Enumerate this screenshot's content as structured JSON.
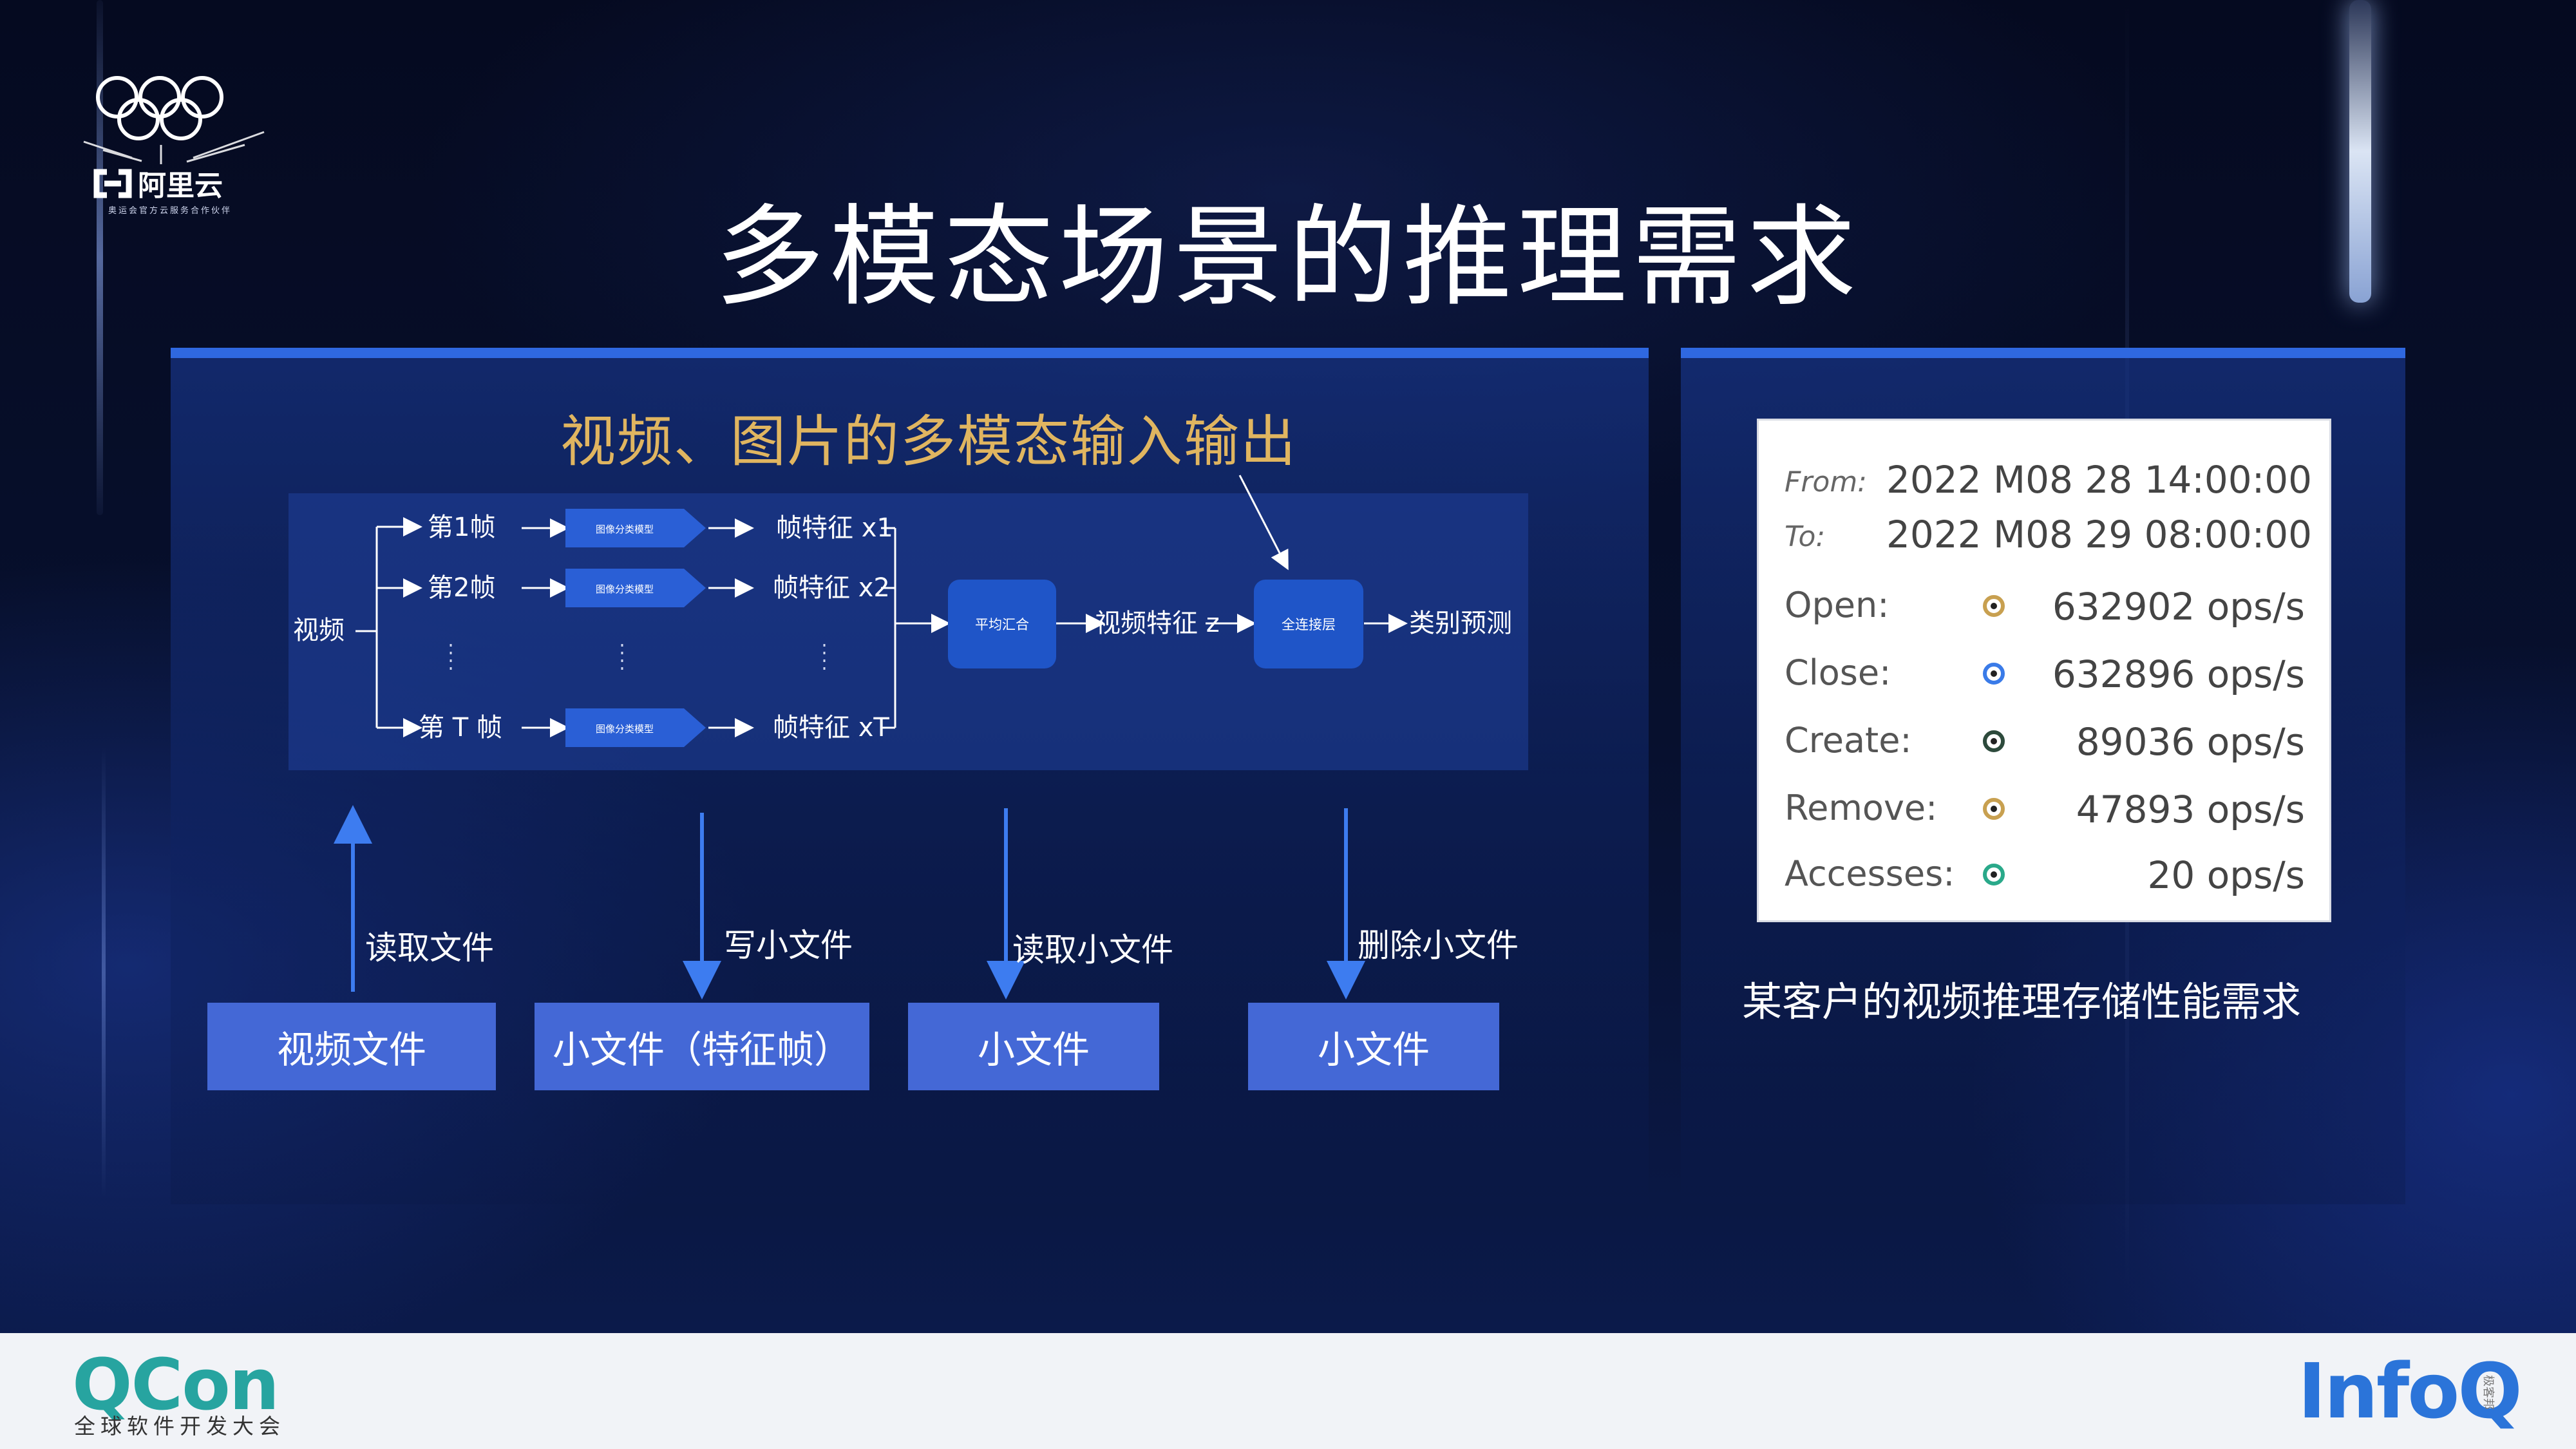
{
  "slide": {
    "title": "多模态场景的推理需求",
    "logo_brand": "阿里云",
    "logo_tagline": "奥运会官方云服务合作伙伴"
  },
  "left_panel": {
    "subtitle": "视频、图片的多模态输入输出",
    "diagram": {
      "source": "视频",
      "frames": [
        "第1帧",
        "第2帧",
        "第 T 帧"
      ],
      "classifier": "图像分类模型",
      "features": [
        "帧特征 x1",
        "帧特征 x2",
        "帧特征 xT"
      ],
      "pool_node": "平均汇合",
      "video_feature": "视频特征 z",
      "fc_node": "全连接层",
      "output": "类别预测"
    },
    "operations": [
      "读取文件",
      "写小文件",
      "读取小文件",
      "删除小文件"
    ],
    "files": [
      "视频文件",
      "小文件（特征帧）",
      "小文件",
      "小文件"
    ]
  },
  "right_panel": {
    "stats": {
      "from_label": "From:",
      "from_value": "2022 M08 28 14:00:00",
      "to_label": "To:",
      "to_value": "2022 M08 29 08:00:00",
      "rows": [
        {
          "label": "Open:",
          "value": "632902 ops/s",
          "color": "#c8a050"
        },
        {
          "label": "Close:",
          "value": "632896 ops/s",
          "color": "#3a7be8"
        },
        {
          "label": "Create:",
          "value": "89036 ops/s",
          "color": "#2d4a3c"
        },
        {
          "label": "Remove:",
          "value": "47893 ops/s",
          "color": "#c8a050"
        },
        {
          "label": "Accesses:",
          "value": "20 ops/s",
          "color": "#2aa98a"
        }
      ]
    },
    "caption": "某客户的视频推理存储性能需求"
  },
  "footer": {
    "qcon": "QCon",
    "qcon_sub": "全球软件开发大会",
    "infoq": "InfoQ",
    "infoq_tm": "极客邦"
  },
  "colors": {
    "panel_bar": "#2f68e0",
    "subtitle": "#e0b560",
    "node": "#1f55c8",
    "file_box": "#4468d6",
    "qcon": "#27a4a0",
    "infoq": "#2b74d9"
  }
}
